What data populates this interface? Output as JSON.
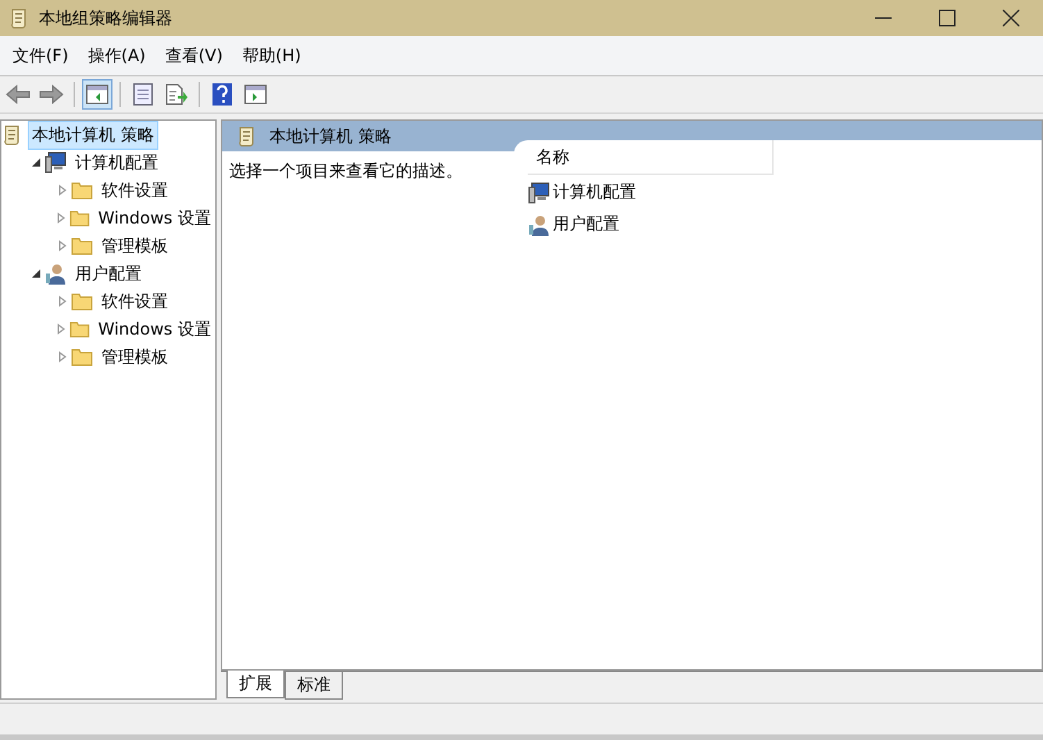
{
  "window": {
    "title": "本地组策略编辑器"
  },
  "menu": [
    "文件(F)",
    "操作(A)",
    "查看(V)",
    "帮助(H)"
  ],
  "toolbar": [
    {
      "kind": "back",
      "on": false
    },
    {
      "kind": "forward",
      "on": false
    },
    {
      "kind": "tree",
      "on": true
    },
    {
      "kind": "properties",
      "on": false
    },
    {
      "kind": "export",
      "on": false
    },
    {
      "kind": "help",
      "on": false
    },
    {
      "kind": "pane",
      "on": false
    }
  ],
  "tree": {
    "label": "本地计算机 策略",
    "selected": true,
    "children": [
      {
        "label": "计算机配置",
        "kind": "computer",
        "expanded": true,
        "selected": false,
        "children": [
          {
            "label": "软件设置",
            "kind": "folder",
            "expanded": false,
            "selected": false
          },
          {
            "label": "Windows 设置",
            "kind": "folder",
            "expanded": false,
            "selected": false
          },
          {
            "label": "管理模板",
            "kind": "folder",
            "expanded": false,
            "selected": false
          }
        ]
      },
      {
        "label": "用户配置",
        "kind": "user",
        "expanded": true,
        "selected": false,
        "children": [
          {
            "label": "软件设置",
            "kind": "folder",
            "expanded": false,
            "selected": false
          },
          {
            "label": "Windows 设置",
            "kind": "folder",
            "expanded": false,
            "selected": false
          },
          {
            "label": "管理模板",
            "kind": "folder",
            "expanded": false,
            "selected": false
          }
        ]
      }
    ]
  },
  "details": {
    "title": "本地计算机 策略",
    "description": "选择一个项目来查看它的描述。",
    "columns": [
      "名称"
    ],
    "rows": [
      {
        "name": "计算机配置",
        "kind": "computer"
      },
      {
        "name": "用户配置",
        "kind": "user"
      }
    ]
  },
  "tabs": [
    {
      "label": "扩展",
      "selected": true
    },
    {
      "label": "标准",
      "selected": false
    }
  ]
}
